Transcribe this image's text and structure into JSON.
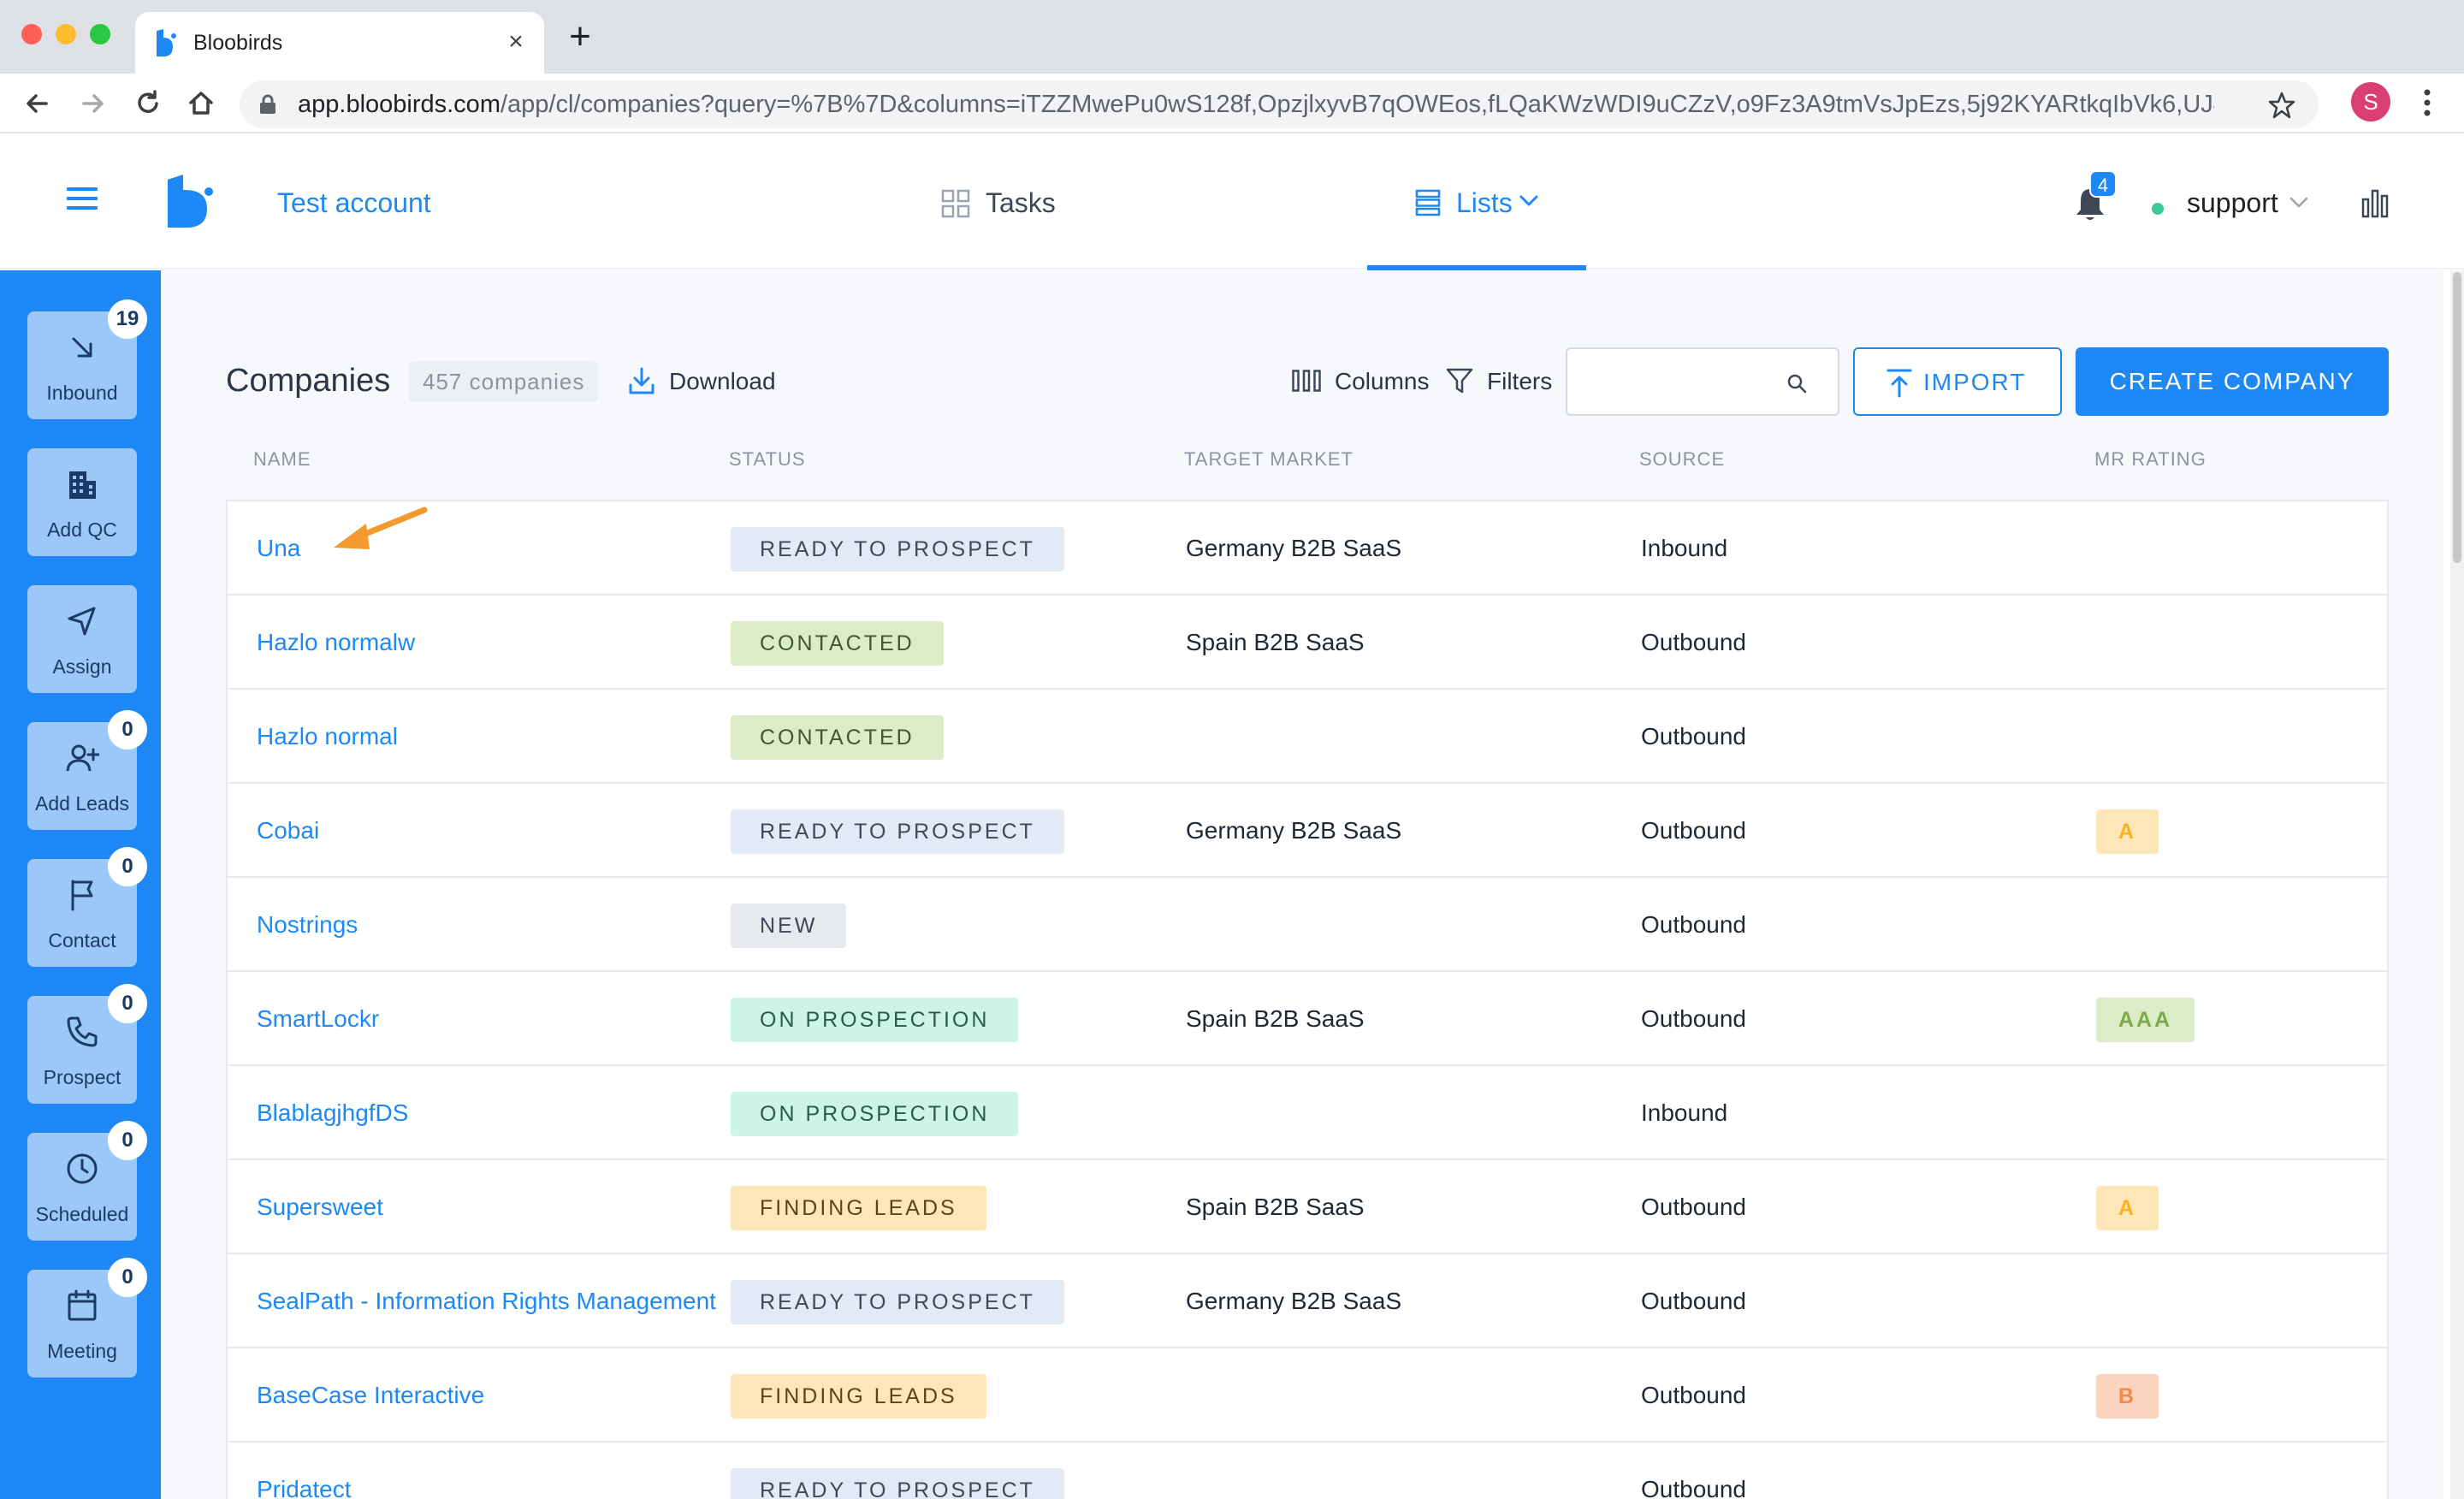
{
  "browser": {
    "tab_title": "Bloobirds",
    "tab_close": "×",
    "new_tab": "+",
    "url_host": "app.bloobirds.com",
    "url_path": "/app/cl/companies?query=%7B%7D&columns=iTZZMwePu0wS128f,OpzjlxyvB7qOWEos,fLQaKWzWDI9uCZzV,o9Fz3A9tmVsJpEzs,5j92KYARtkqIbVk6,UJ4B32HO...",
    "profile_initial": "S"
  },
  "header": {
    "account": "Test account",
    "nav_tasks": "Tasks",
    "nav_lists": "Lists",
    "notifications": "4",
    "user": "support"
  },
  "sidebar": {
    "items": [
      {
        "label": "Inbound",
        "badge": "19",
        "icon": "arrow-down-right-icon"
      },
      {
        "label": "Add QC",
        "badge": "",
        "icon": "building-icon"
      },
      {
        "label": "Assign",
        "badge": "",
        "icon": "send-icon"
      },
      {
        "label": "Add Leads",
        "badge": "0",
        "icon": "user-plus-icon"
      },
      {
        "label": "Contact",
        "badge": "0",
        "icon": "flag-icon"
      },
      {
        "label": "Prospect",
        "badge": "0",
        "icon": "phone-icon"
      },
      {
        "label": "Scheduled",
        "badge": "0",
        "icon": "clock-icon"
      },
      {
        "label": "Meeting",
        "badge": "0",
        "icon": "calendar-icon"
      }
    ]
  },
  "page": {
    "title": "Companies",
    "count": "457 companies",
    "download": "Download",
    "columns": "Columns",
    "filters": "Filters",
    "search_placeholder": "",
    "import": "IMPORT",
    "create": "CREATE COMPANY"
  },
  "table": {
    "headers": [
      "NAME",
      "STATUS",
      "TARGET MARKET",
      "SOURCE",
      "MR RATING"
    ],
    "rows": [
      {
        "name": "Una",
        "status": "READY TO PROSPECT",
        "market": "Germany B2B SaaS",
        "source": "Inbound",
        "rating": ""
      },
      {
        "name": "Hazlo normalw",
        "status": "CONTACTED",
        "market": "Spain B2B SaaS",
        "source": "Outbound",
        "rating": ""
      },
      {
        "name": "Hazlo normal",
        "status": "CONTACTED",
        "market": "",
        "source": "Outbound",
        "rating": ""
      },
      {
        "name": "Cobai",
        "status": "READY TO PROSPECT",
        "market": "Germany B2B SaaS",
        "source": "Outbound",
        "rating": "A"
      },
      {
        "name": "Nostrings",
        "status": "NEW",
        "market": "",
        "source": "Outbound",
        "rating": ""
      },
      {
        "name": "SmartLockr",
        "status": "ON PROSPECTION",
        "market": "Spain B2B SaaS",
        "source": "Outbound",
        "rating": "AAA"
      },
      {
        "name": "BlablagjhgfDS",
        "status": "ON PROSPECTION",
        "market": "",
        "source": "Inbound",
        "rating": ""
      },
      {
        "name": "Supersweet",
        "status": "FINDING LEADS",
        "market": "Spain B2B SaaS",
        "source": "Outbound",
        "rating": "A"
      },
      {
        "name": "SealPath - Information Rights Management",
        "status": "READY TO PROSPECT",
        "market": "Germany B2B SaaS",
        "source": "Outbound",
        "rating": ""
      },
      {
        "name": "BaseCase Interactive",
        "status": "FINDING LEADS",
        "market": "",
        "source": "Outbound",
        "rating": "B"
      },
      {
        "name": "Pridatect",
        "status": "READY TO PROSPECT",
        "market": "",
        "source": "Outbound",
        "rating": ""
      }
    ]
  },
  "status_colors": {
    "READY TO PROSPECT": {
      "bg": "#e1eaf5",
      "fg": "#3d4a5c"
    },
    "CONTACTED": {
      "bg": "#dcebc8",
      "fg": "#3f5a2a"
    },
    "NEW": {
      "bg": "#e6e9ee",
      "fg": "#3d4756"
    },
    "ON PROSPECTION": {
      "bg": "#cdf5e6",
      "fg": "#2a5b4a"
    },
    "FINDING LEADS": {
      "bg": "#fde7b8",
      "fg": "#5c4416"
    }
  },
  "rating_colors": {
    "A": {
      "bg": "#fde7b8",
      "fg": "#f5b520"
    },
    "AAA": {
      "bg": "#dcebc8",
      "fg": "#7dab4a"
    },
    "B": {
      "bg": "#fbd4c0",
      "fg": "#f08a44"
    }
  },
  "colors": {
    "brand": "#1d88f6",
    "annotation_arrow": "#f39a2e"
  }
}
